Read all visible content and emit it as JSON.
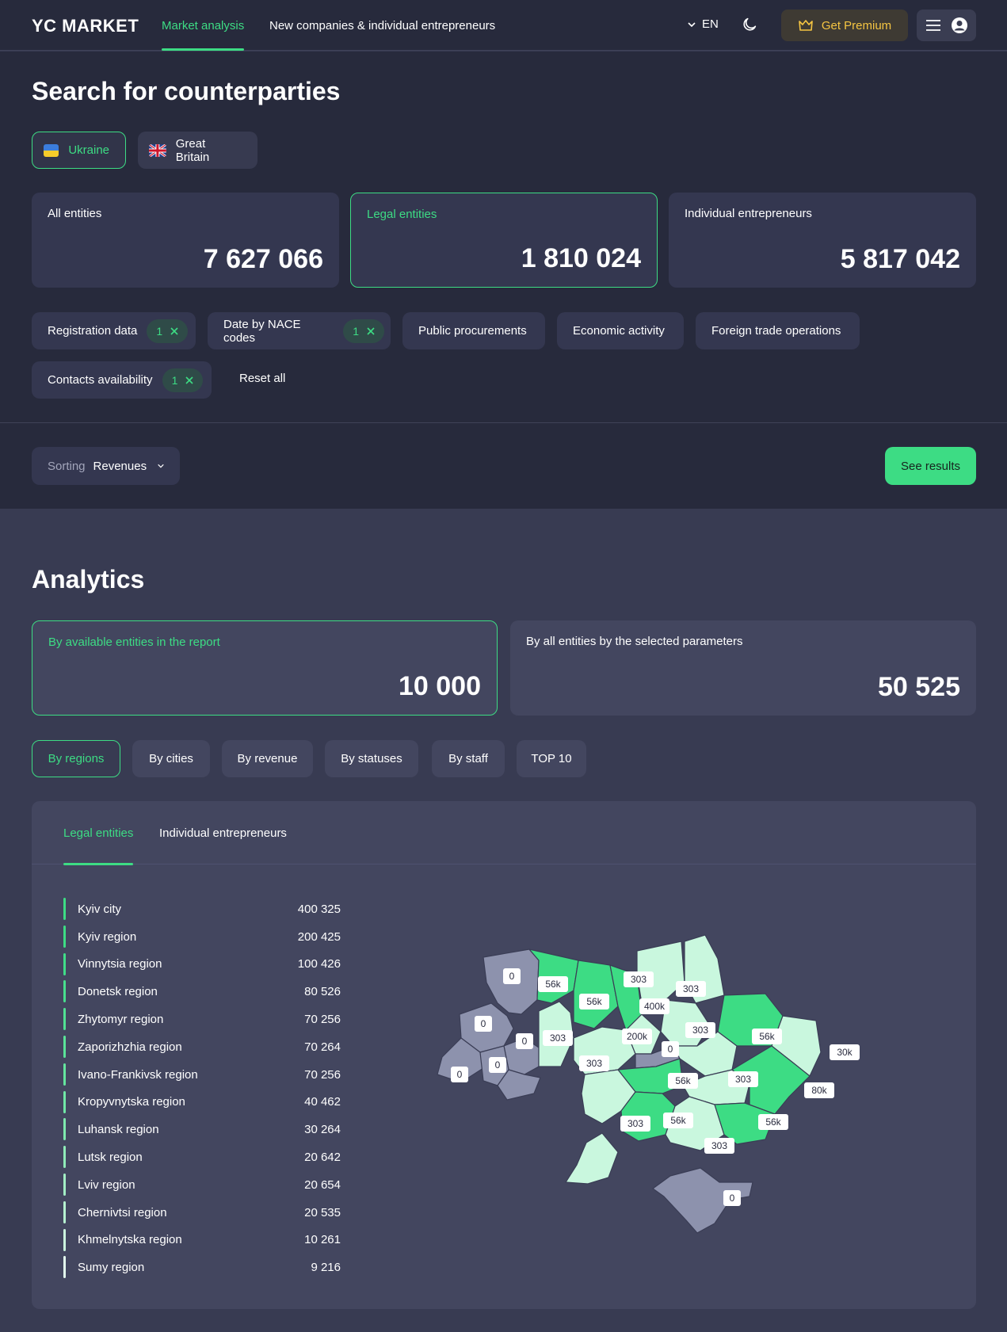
{
  "header": {
    "logo": "YC MARKET",
    "nav": [
      "Market analysis",
      "New companies & individual entrepreneurs"
    ],
    "lang": "EN",
    "premium": "Get Premium"
  },
  "search": {
    "title": "Search for counterparties",
    "countries": [
      "Ukraine",
      "Great Britain"
    ],
    "stats": [
      {
        "label": "All entities",
        "value": "7 627 066"
      },
      {
        "label": "Legal entities",
        "value": "1 810 024"
      },
      {
        "label": "Individual entrepreneurs",
        "value": "5 817 042"
      }
    ],
    "filters": [
      {
        "label": "Registration data",
        "count": "1"
      },
      {
        "label": "Date by NACE codes",
        "count": "1"
      },
      {
        "label": "Public procurements"
      },
      {
        "label": "Economic activity"
      },
      {
        "label": "Foreign trade operations"
      },
      {
        "label": "Contacts availability",
        "count": "1"
      }
    ],
    "reset_all": "Reset all",
    "sorting_label": "Sorting",
    "sorting_value": "Revenues",
    "see_results": "See results"
  },
  "analytics": {
    "title": "Analytics",
    "stats": [
      {
        "label": "By available entities in the report",
        "value": "10 000"
      },
      {
        "label": "By all entities by the selected parameters",
        "value": "50 525"
      }
    ],
    "tabs": [
      "By regions",
      "By cities",
      "By revenue",
      "By statuses",
      "By staff",
      "TOP 10"
    ],
    "panel_tabs": [
      "Legal entities",
      "Individual entrepreneurs"
    ],
    "regions": [
      {
        "name": "Kyiv city",
        "value": "400 325"
      },
      {
        "name": "Kyiv region",
        "value": "200 425"
      },
      {
        "name": "Vinnytsia region",
        "value": "100 426"
      },
      {
        "name": "Donetsk region",
        "value": "80 526"
      },
      {
        "name": "Zhytomyr region",
        "value": "70 256"
      },
      {
        "name": "Zaporizhzhia region",
        "value": "70 264"
      },
      {
        "name": "Ivano-Frankivsk region",
        "value": "70 256"
      },
      {
        "name": "Kropyvnytska region",
        "value": "40 462"
      },
      {
        "name": "Luhansk region",
        "value": "30 264"
      },
      {
        "name": "Lutsk region",
        "value": "20 642"
      },
      {
        "name": "Lviv region",
        "value": "20 654"
      },
      {
        "name": "Chernivtsi region",
        "value": "20 535"
      },
      {
        "name": "Khmelnytska region",
        "value": "10 261"
      },
      {
        "name": "Sumy region",
        "value": "9 216"
      }
    ],
    "map_labels": [
      "0",
      "56k",
      "56k",
      "303",
      "303",
      "400k",
      "0",
      "0",
      "303",
      "200k",
      "0",
      "303",
      "56k",
      "30k",
      "0",
      "303",
      "0",
      "56k",
      "303",
      "80k",
      "303",
      "56k",
      "56k",
      "303",
      "0"
    ]
  },
  "colors": {
    "accent": "#3ddc84",
    "premium": "#f5c542",
    "background": "#383b52",
    "header": "#272a3c"
  }
}
